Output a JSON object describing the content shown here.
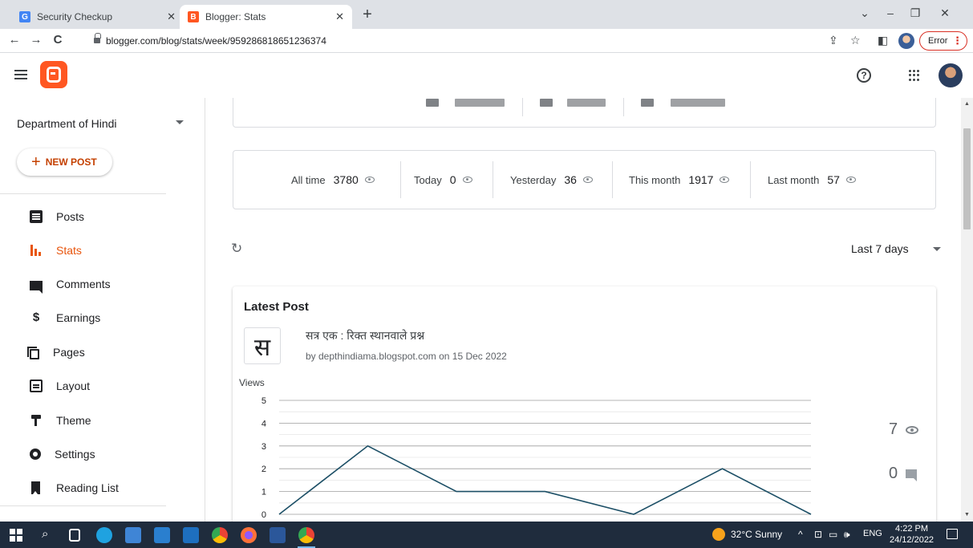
{
  "browser": {
    "tabs": [
      {
        "title": "Security Checkup",
        "favicon": "G",
        "favicon_color": "#4285f4"
      },
      {
        "title": "Blogger: Stats",
        "favicon": "B",
        "favicon_color": "#ff5722"
      }
    ],
    "url": "blogger.com/blog/stats/week/959286818651236374",
    "profile_status": "Error"
  },
  "sidebar": {
    "blog_name": "Department of Hindi",
    "new_post_label": "NEW POST",
    "items": [
      {
        "label": "Posts",
        "icon": "posts-icon"
      },
      {
        "label": "Stats",
        "icon": "stats-icon",
        "active": true
      },
      {
        "label": "Comments",
        "icon": "comments-icon"
      },
      {
        "label": "Earnings",
        "icon": "dollar-icon",
        "glyph": "$"
      },
      {
        "label": "Pages",
        "icon": "pages-icon"
      },
      {
        "label": "Layout",
        "icon": "layout-icon"
      },
      {
        "label": "Theme",
        "icon": "theme-icon"
      },
      {
        "label": "Settings",
        "icon": "gear-icon"
      },
      {
        "label": "Reading List",
        "icon": "bookmark-icon"
      }
    ],
    "accent_color": "#e8550d"
  },
  "stats": {
    "all_time_label": "All time",
    "all_time_value": "3780",
    "today_label": "Today",
    "today_value": "0",
    "yesterday_label": "Yesterday",
    "yesterday_value": "36",
    "this_month_label": "This month",
    "this_month_value": "1917",
    "last_month_label": "Last month",
    "last_month_value": "57"
  },
  "range": {
    "selected": "Last 7 days"
  },
  "latest_post": {
    "heading": "Latest Post",
    "thumbnail_glyph": "स",
    "title": "सत्र एक : रिक्त स्थानवाले प्रश्न",
    "meta": "by depthindiama.blogspot.com on 15 Dec 2022",
    "views_total": "7",
    "comments_total": "0"
  },
  "chart_data": {
    "type": "line",
    "ylabel": "Views",
    "ylim": [
      0,
      5
    ],
    "yticks": [
      "5",
      "4",
      "3",
      "2",
      "1",
      "0"
    ],
    "x": [
      1,
      2,
      3,
      4,
      5,
      6,
      7
    ],
    "values": [
      0,
      3,
      1,
      1,
      0,
      2,
      0
    ],
    "line_color": "#1c4f66"
  },
  "taskbar": {
    "weather": "32°C  Sunny",
    "language": "ENG",
    "time": "4:22 PM",
    "date": "24/12/2022"
  }
}
